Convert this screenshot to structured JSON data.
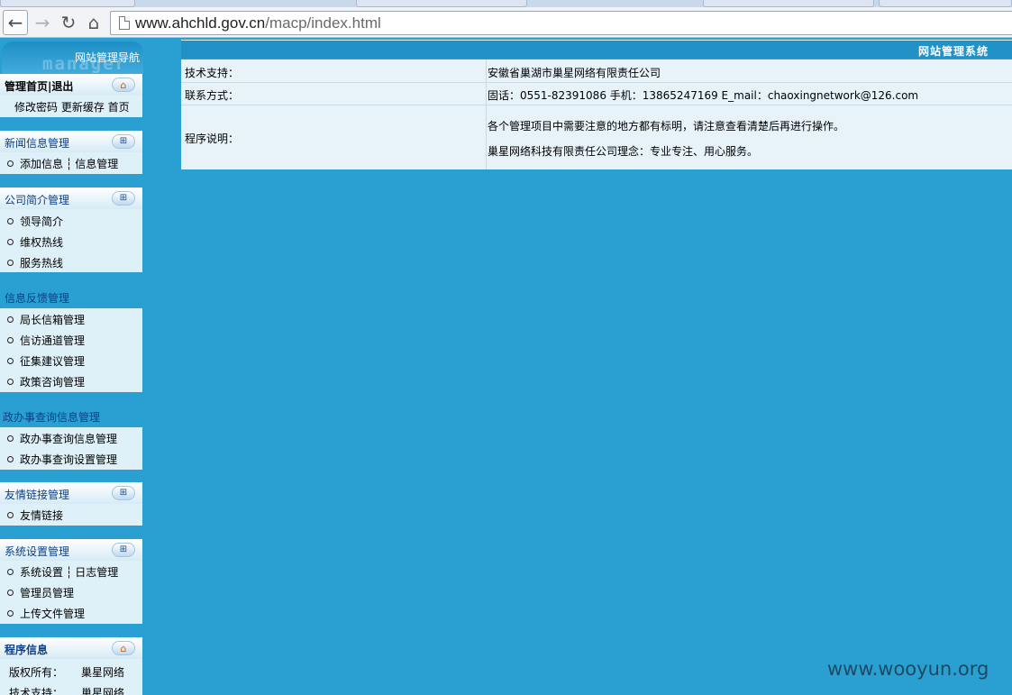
{
  "browser": {
    "url_host": "www.ahchld.gov.cn",
    "url_path": "/macp/index.html"
  },
  "nav": {
    "title": "网站管理导航",
    "watermark": "manager",
    "home_group": {
      "home": "管理首页",
      "sep": "|",
      "logout": "退出",
      "links": "修改密码 更新缓存 首页"
    },
    "news_group": {
      "title": "新闻信息管理",
      "item_add": "添加信息",
      "sep": "┆",
      "item_manage": "信息管理"
    },
    "company_group": {
      "title": "公司简介管理",
      "items": [
        "领导简介",
        "维权热线",
        "服务热线"
      ]
    },
    "feedback_group": {
      "title": "信息反馈管理",
      "items": [
        "局长信箱管理",
        "信访通道管理",
        "征集建议管理",
        "政策咨询管理"
      ]
    },
    "gov_group": {
      "title": "政办事查询信息管理",
      "items": [
        "政办事查询信息管理",
        "政办事查询设置管理"
      ]
    },
    "links_group": {
      "title": "友情链接管理",
      "items": [
        "友情链接"
      ]
    },
    "system_group": {
      "title": "系统设置管理",
      "item_settings": "系统设置",
      "sep": "┆",
      "item_log": "日志管理",
      "items": [
        "管理员管理",
        "上传文件管理"
      ]
    },
    "program_group": {
      "title": "程序信息",
      "rows": [
        {
          "key": "版权所有：",
          "value": "巢星网络"
        },
        {
          "key": "技术支持：",
          "value": "巢星网络"
        }
      ]
    }
  },
  "main": {
    "title": "网站管理系统",
    "rows": {
      "support": {
        "key": "技术支持：",
        "value": "安徽省巢湖市巢星网络有限责任公司"
      },
      "contact": {
        "key": "联系方式：",
        "value": "固话：0551-82391086 手机：13865247169 E_mail：chaoxingnetwork@126.com"
      },
      "notes": {
        "key": "程序说明：",
        "line1": "各个管理项目中需要注意的地方都有标明，请注意查看清楚后再进行操作。",
        "line2": "巢星网络科技有限责任公司理念：专业专注、用心服务。"
      }
    }
  },
  "watermark": "www.wooyun.org",
  "icons": {
    "back": "back-arrow-icon",
    "forward": "forward-arrow-icon",
    "reload": "reload-icon",
    "home": "home-icon",
    "expand": "plus-icon",
    "house": "house-icon"
  },
  "colors": {
    "page_bg": "#2aa0d2",
    "header_bar": "#2291c8",
    "panel_bg": "#def0f8",
    "group_title": "#0b3f89"
  }
}
